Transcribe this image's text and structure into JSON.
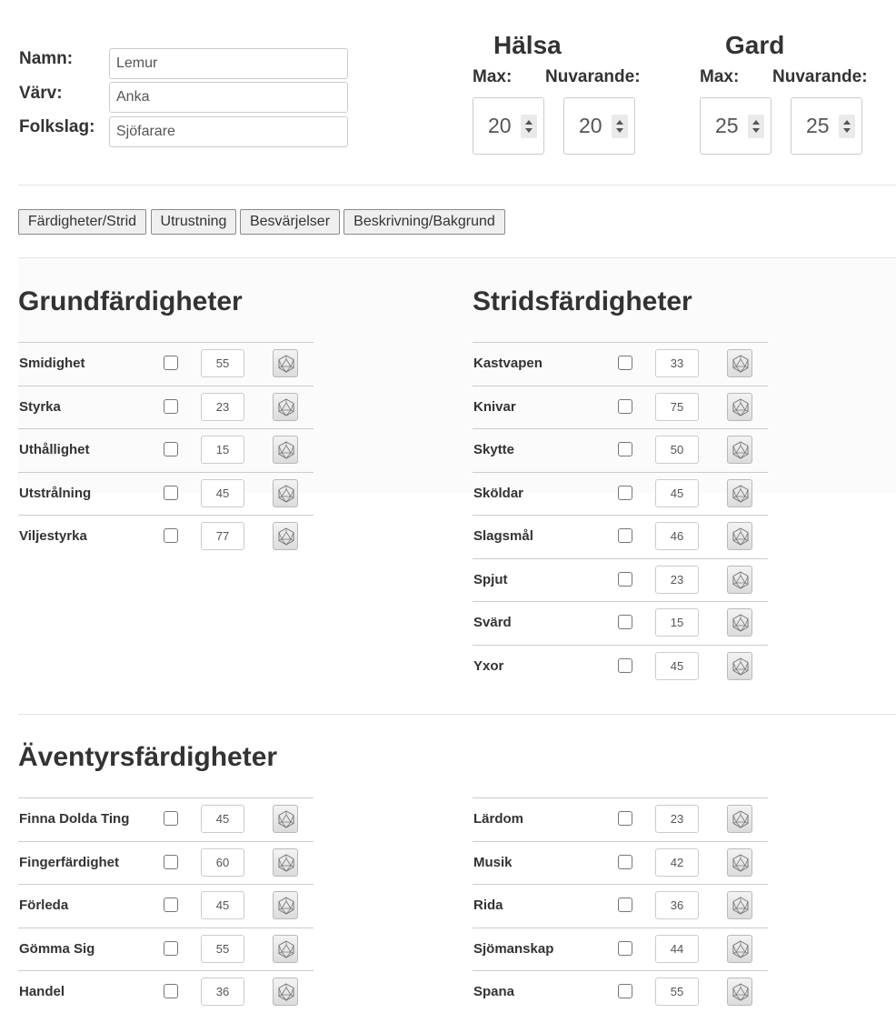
{
  "header": {
    "name_label": "Namn:",
    "name_value": "Lemur",
    "varv_label": "Värv:",
    "varv_value": "Anka",
    "folkslag_label": "Folkslag:",
    "folkslag_value": "Sjöfarare"
  },
  "stats": {
    "halsa": {
      "title": "Hälsa",
      "max_label": "Max:",
      "current_label": "Nuvarande:",
      "max": "20",
      "current": "20"
    },
    "gard": {
      "title": "Gard",
      "max_label": "Max:",
      "current_label": "Nuvarande:",
      "max": "25",
      "current": "25"
    }
  },
  "tabs": [
    "Färdigheter/Strid",
    "Utrustning",
    "Besvärjelser",
    "Beskrivning/Bakgrund"
  ],
  "sections": {
    "grund": {
      "title": "Grundfärdigheter",
      "skills": [
        {
          "name": "Smidighet",
          "value": "55"
        },
        {
          "name": "Styrka",
          "value": "23"
        },
        {
          "name": "Uthållighet",
          "value": "15"
        },
        {
          "name": "Utstrålning",
          "value": "45"
        },
        {
          "name": "Viljestyrka",
          "value": "77"
        }
      ]
    },
    "strid": {
      "title": "Stridsfärdigheter",
      "skills": [
        {
          "name": "Kastvapen",
          "value": "33"
        },
        {
          "name": "Knivar",
          "value": "75"
        },
        {
          "name": "Skytte",
          "value": "50"
        },
        {
          "name": "Sköldar",
          "value": "45"
        },
        {
          "name": "Slagsmål",
          "value": "46"
        },
        {
          "name": "Spjut",
          "value": "23"
        },
        {
          "name": "Svärd",
          "value": "15"
        },
        {
          "name": "Yxor",
          "value": "45"
        }
      ]
    },
    "aventyr": {
      "title": "Äventyrsfärdigheter",
      "left": [
        {
          "name": "Finna Dolda Ting",
          "value": "45"
        },
        {
          "name": "Fingerfärdighet",
          "value": "60"
        },
        {
          "name": "Förleda",
          "value": "45"
        },
        {
          "name": "Gömma Sig",
          "value": "55"
        },
        {
          "name": "Handel",
          "value": "36"
        }
      ],
      "right": [
        {
          "name": "Lärdom",
          "value": "23"
        },
        {
          "name": "Musik",
          "value": "42"
        },
        {
          "name": "Rida",
          "value": "36"
        },
        {
          "name": "Sjömanskap",
          "value": "44"
        },
        {
          "name": "Spana",
          "value": "55"
        }
      ]
    }
  },
  "icons": {
    "roll": "d20-dice-icon",
    "spin_up": "arrow-up-icon",
    "spin_down": "arrow-down-icon"
  }
}
